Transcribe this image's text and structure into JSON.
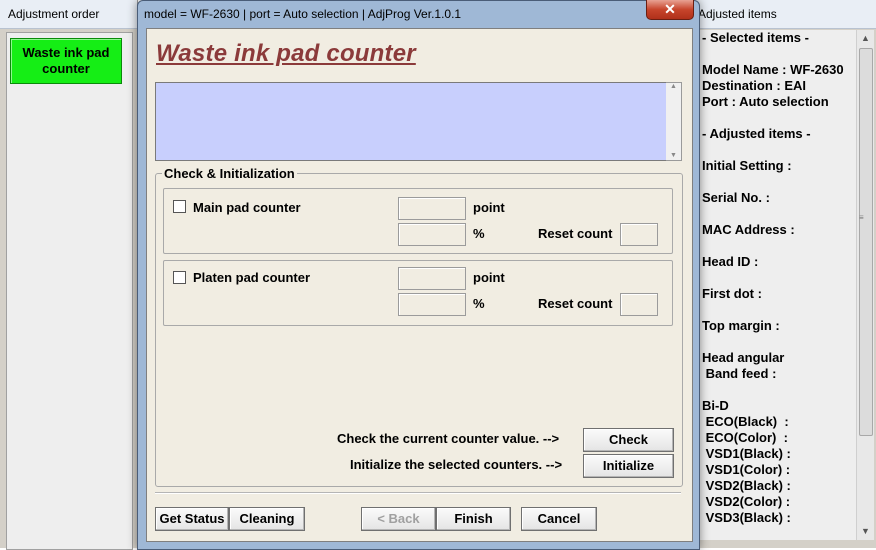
{
  "left_window": {
    "title": "Adjustment order",
    "items": [
      {
        "label_line1": "Waste ink pad",
        "label_line2": "counter",
        "color": "#15ee15"
      }
    ]
  },
  "dialog": {
    "title": "model = WF-2630 | port = Auto selection | AdjProg Ver.1.0.1",
    "close_label": "✕",
    "heading": "Waste ink pad counter",
    "message_text": "",
    "group_label": "Check & Initialization",
    "main_pad": {
      "label": "Main pad counter",
      "point_value": "",
      "percent_value": "",
      "reset_value": ""
    },
    "platen_pad": {
      "label": "Platen pad counter",
      "point_value": "",
      "percent_value": "",
      "reset_value": ""
    },
    "point_unit": "point",
    "percent_unit": "%",
    "reset_label": "Reset count",
    "check_prompt": "Check the current counter value. -->",
    "check_button": "Check",
    "init_prompt": "Initialize the selected counters. -->",
    "init_button": "Initialize",
    "footer": {
      "get_status": "Get Status",
      "cleaning": "Cleaning",
      "back": "< Back",
      "finish": "Finish",
      "cancel": "Cancel"
    }
  },
  "right_window": {
    "title": "Adjusted items",
    "lines": [
      "- Selected items -",
      "Model Name : WF-2630",
      "Destination : EAI",
      "Port : Auto selection",
      "- Adjusted items -",
      "Initial Setting :",
      "Serial No. :",
      "MAC Address :",
      "Head ID :",
      "First dot :",
      "Top margin :",
      "Head angular",
      " Band feed :",
      "Bi-D",
      " ECO(Black)  :",
      " ECO(Color)  :",
      " VSD1(Black) :",
      " VSD1(Color) :",
      " VSD2(Black) :",
      " VSD2(Color) :",
      " VSD3(Black) :"
    ]
  },
  "colors": {
    "heading": "#8b3a3a",
    "message_box": "#c8cffd",
    "dialog_body": "#f1ede2",
    "green_button": "#15ee15",
    "close_button": "#c7452c"
  }
}
